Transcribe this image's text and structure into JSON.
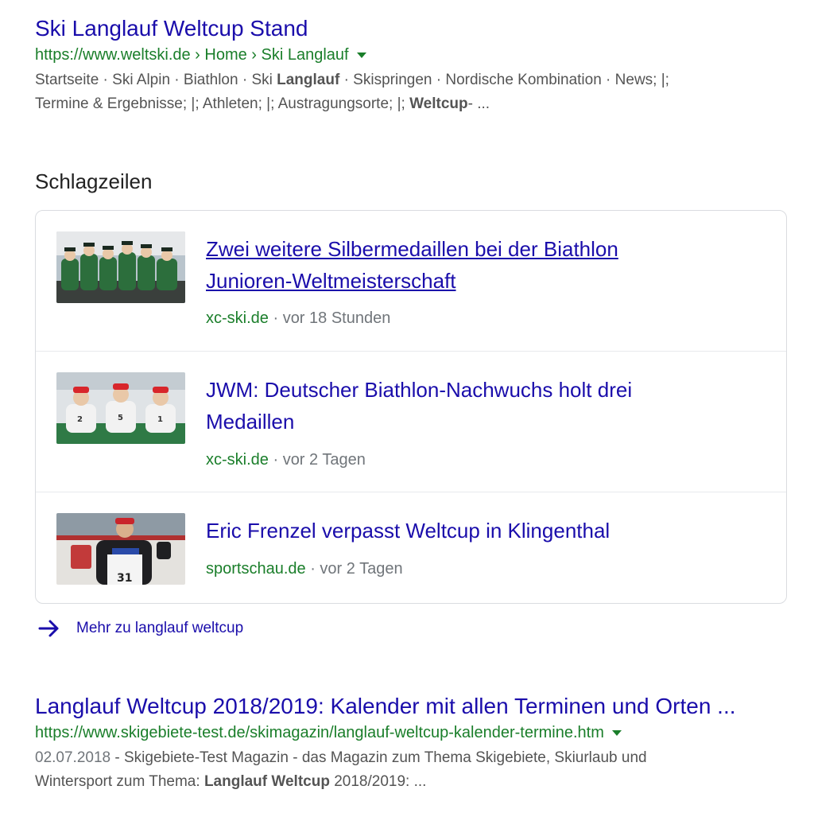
{
  "result1": {
    "title": "Ski Langlauf Weltcup Stand",
    "url": "https://www.weltski.de › Home › Ski Langlauf",
    "snippet_line1_a": "Startseite · Ski Alpin · Biathlon · Ski ",
    "snippet_line1_bold": "Langlauf",
    "snippet_line1_b": " · Skispringen · Nordische Kombination · News; |;",
    "snippet_line2_a": "Termine & Ergebnisse; |; Athleten; |; Austragungsorte; |; ",
    "snippet_line2_bold": "Weltcup",
    "snippet_line2_b": "- ..."
  },
  "headlines": {
    "section_title": "Schlagzeilen",
    "items": [
      {
        "title_line1": "Zwei weitere Silbermedaillen bei der Biathlon",
        "title_line2": "Junioren-Weltmeisterschaft",
        "source": "xc-ski.de",
        "separator": " · ",
        "time": "vor 18 Stunden",
        "thumb_icon": "biathlon-team-photo"
      },
      {
        "title_line1": "JWM: Deutscher Biathlon-Nachwuchs holt drei",
        "title_line2": "Medaillen",
        "source": "xc-ski.de",
        "separator": " · ",
        "time": "vor 2 Tagen",
        "thumb_icon": "podium-athletes-photo"
      },
      {
        "title_line1": "Eric Frenzel verpasst Weltcup in Klingenthal",
        "title_line2": "",
        "source": "sportschau.de",
        "separator": " · ",
        "time": "vor 2 Tagen",
        "thumb_icon": "athlete-bib-31-photo"
      }
    ],
    "more_label": "Mehr zu langlauf weltcup"
  },
  "result2": {
    "title": "Langlauf Weltcup 2018/2019: Kalender mit allen Terminen und Orten ...",
    "url": "https://www.skigebiete-test.de/skimagazin/langlauf-weltcup-kalender-termine.htm",
    "date": "02.07.2018",
    "snippet_line1": " - Skigebiete-Test Magazin - das Magazin zum Thema Skigebiete, Skiurlaub und",
    "snippet_line2_a": "Wintersport zum Thema: ",
    "snippet_line2_bold": "Langlauf Weltcup",
    "snippet_line2_b": " 2018/2019: ..."
  },
  "colors": {
    "link": "#1a0dab",
    "url_green": "#1a7e2a",
    "snippet_gray": "#545454",
    "meta_gray": "#70757a",
    "card_border": "#dadce0"
  }
}
